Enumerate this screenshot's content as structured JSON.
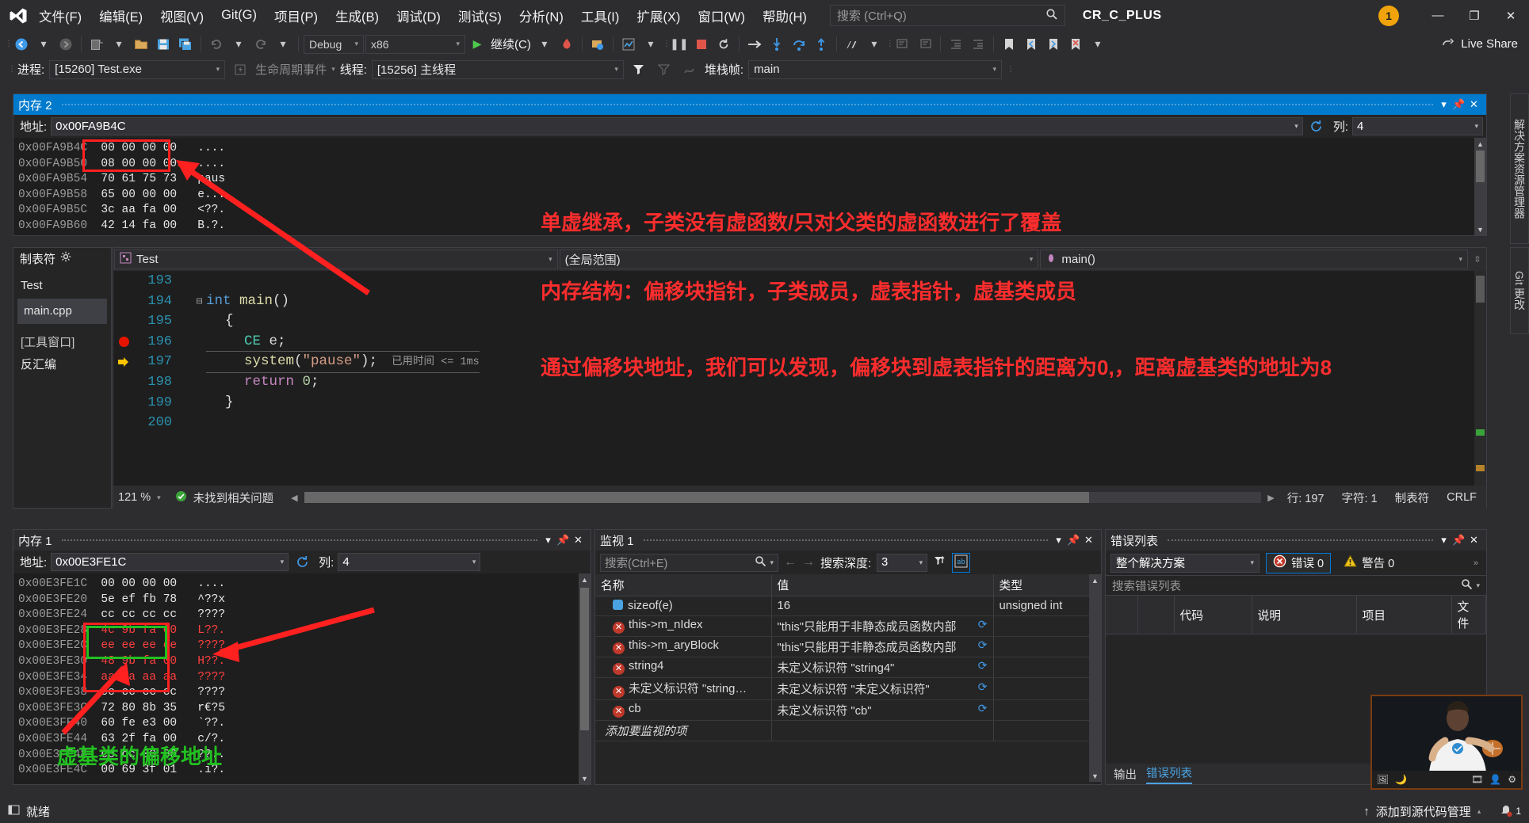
{
  "window": {
    "project_name": "CR_C_PLUS",
    "notification_count": "1",
    "minimize": "—",
    "restore": "❐",
    "close": "✕",
    "live_share": "Live Share"
  },
  "menu": {
    "items": [
      {
        "label": "文件(F)"
      },
      {
        "label": "编辑(E)"
      },
      {
        "label": "视图(V)"
      },
      {
        "label": "Git(G)"
      },
      {
        "label": "项目(P)"
      },
      {
        "label": "生成(B)"
      },
      {
        "label": "调试(D)"
      },
      {
        "label": "测试(S)"
      },
      {
        "label": "分析(N)"
      },
      {
        "label": "工具(I)"
      },
      {
        "label": "扩展(X)"
      },
      {
        "label": "窗口(W)"
      },
      {
        "label": "帮助(H)"
      }
    ],
    "search_placeholder": "搜索 (Ctrl+Q)"
  },
  "toolbar": {
    "configuration": "Debug",
    "platform": "x86",
    "continue_label": "继续(C)"
  },
  "debugbar": {
    "process_label": "进程:",
    "process_value": "[15260] Test.exe",
    "lifecycle_label": "生命周期事件",
    "thread_label": "线程:",
    "thread_value": "[15256] 主线程",
    "stackframe_label": "堆栈帧:",
    "stackframe_value": "main"
  },
  "memory2": {
    "title": "内存 2",
    "address_label": "地址:",
    "address_value": "0x00FA9B4C",
    "column_label": "列:",
    "column_value": "4",
    "rows": [
      {
        "addr": "0x00FA9B4C",
        "hex": "00 00 00 00",
        "ascii": "....",
        "hl": false
      },
      {
        "addr": "0x00FA9B50",
        "hex": "08 00 00 00",
        "ascii": "....",
        "hl": false
      },
      {
        "addr": "0x00FA9B54",
        "hex": "70 61 75 73",
        "ascii": "paus",
        "hl": false
      },
      {
        "addr": "0x00FA9B58",
        "hex": "65 00 00 00",
        "ascii": "e...",
        "hl": false
      },
      {
        "addr": "0x00FA9B5C",
        "hex": "3c aa fa 00",
        "ascii": "<??.",
        "hl": false
      },
      {
        "addr": "0x00FA9B60",
        "hex": "42 14 fa 00",
        "ascii": "B.?.",
        "hl": false
      }
    ]
  },
  "memory1": {
    "title": "内存 1",
    "address_label": "地址:",
    "address_value": "0x00E3FE1C",
    "column_label": "列:",
    "column_value": "4",
    "rows": [
      {
        "addr": "0x00E3FE1C",
        "hex": "00 00 00 00",
        "ascii": "....",
        "hl": false
      },
      {
        "addr": "0x00E3FE20",
        "hex": "5e ef fb 78",
        "ascii": "^??x",
        "hl": false
      },
      {
        "addr": "0x00E3FE24",
        "hex": "cc cc cc cc",
        "ascii": "????",
        "hl": false
      },
      {
        "addr": "0x00E3FE28",
        "hex": "4c 9b fa 00",
        "ascii": "L??.",
        "hl": true
      },
      {
        "addr": "0x00E3FE2C",
        "hex": "ee ee ee ee",
        "ascii": "????",
        "hl": true
      },
      {
        "addr": "0x00E3FE30",
        "hex": "48 9b fa 00",
        "ascii": "H??.",
        "hl": true
      },
      {
        "addr": "0x00E3FE34",
        "hex": "aa aa aa aa",
        "ascii": "????",
        "hl": true
      },
      {
        "addr": "0x00E3FE38",
        "hex": "cc cc cc cc",
        "ascii": "????",
        "hl": false
      },
      {
        "addr": "0x00E3FE3C",
        "hex": "72 80 8b 35",
        "ascii": "r€?5",
        "hl": false
      },
      {
        "addr": "0x00E3FE40",
        "hex": "60 fe e3 00",
        "ascii": "`??.",
        "hl": false
      },
      {
        "addr": "0x00E3FE44",
        "hex": "63 2f fa 00",
        "ascii": "c/?.",
        "hl": false
      },
      {
        "addr": "0x00E3FE48",
        "hex": "cc cc 00 00",
        "ascii": "??..",
        "hl": false
      },
      {
        "addr": "0x00E3FE4C",
        "hex": "00 69 3f 01",
        "ascii": ".i?.",
        "hl": false
      }
    ]
  },
  "sidebar_left": {
    "tab_label": "制表符",
    "project": "Test",
    "file": "main.cpp",
    "section": "[工具窗口]",
    "disasm": "反汇编"
  },
  "editor": {
    "tab_label": "Test",
    "scope_combo": "(全局范围)",
    "member_combo": "main()",
    "lines": [
      {
        "no": "193",
        "segments": []
      },
      {
        "no": "194",
        "segments": [
          {
            "t": "int ",
            "c": "k-blue"
          },
          {
            "t": "main",
            "c": "k-yel"
          },
          {
            "t": "()",
            "c": "k-wht"
          }
        ],
        "fold": true
      },
      {
        "no": "195",
        "segments": [
          {
            "t": "{",
            "c": "k-wht"
          }
        ],
        "indent": 1
      },
      {
        "no": "196",
        "segments": [
          {
            "t": "CE",
            "c": "k-teal"
          },
          {
            "t": " e;",
            "c": "k-wht"
          }
        ],
        "indent": 2,
        "breakpoint": true
      },
      {
        "no": "197",
        "segments": [
          {
            "t": "system",
            "c": "k-yel"
          },
          {
            "t": "(",
            "c": "k-wht"
          },
          {
            "t": "\"pause\"",
            "c": "k-str"
          },
          {
            "t": ");",
            "c": "k-wht"
          }
        ],
        "indent": 2,
        "current": true,
        "inline_hint": "已用时间 <= 1ms"
      },
      {
        "no": "198",
        "segments": [
          {
            "t": "return ",
            "c": "k-mag"
          },
          {
            "t": "0",
            "c": "k-num"
          },
          {
            "t": ";",
            "c": "k-wht"
          }
        ],
        "indent": 2
      },
      {
        "no": "199",
        "segments": [
          {
            "t": "}",
            "c": "k-wht"
          }
        ],
        "indent": 1
      },
      {
        "no": "200",
        "segments": []
      }
    ],
    "zoom": "121 %",
    "issues": "未找到相关问题",
    "line_label": "行: 197",
    "char_label": "字符: 1",
    "tabs_label": "制表符",
    "eol_label": "CRLF"
  },
  "watch": {
    "title": "监视 1",
    "search_placeholder": "搜索(Ctrl+E)",
    "depth_label": "搜索深度:",
    "depth_value": "3",
    "columns": [
      "名称",
      "值",
      "类型"
    ],
    "rows": [
      {
        "name": "sizeof(e)",
        "value": "16",
        "type": "unsigned int",
        "icon": "blue",
        "refresh": false
      },
      {
        "name": "this->m_nIdex",
        "value": "\"this\"只能用于非静态成员函数内部",
        "type": "",
        "icon": "error",
        "refresh": true
      },
      {
        "name": "this->m_aryBlock",
        "value": "\"this\"只能用于非静态成员函数内部",
        "type": "",
        "icon": "error",
        "refresh": true
      },
      {
        "name": "string4",
        "value": "未定义标识符 \"string4\"",
        "type": "",
        "icon": "error",
        "refresh": true
      },
      {
        "name": "未定义标识符 \"string…",
        "value": "未定义标识符 \"未定义标识符\"",
        "type": "",
        "icon": "error",
        "refresh": true
      },
      {
        "name": "cb",
        "value": "未定义标识符 \"cb\"",
        "type": "",
        "icon": "error",
        "refresh": true
      }
    ],
    "add_row": "添加要监视的项"
  },
  "errorlist": {
    "title": "错误列表",
    "scope": "整个解决方案",
    "errors_label": "错误 0",
    "warnings_label": "警告 0",
    "search_placeholder": "搜索错误列表",
    "columns": [
      "",
      "",
      "代码",
      "说明",
      "项目",
      "文件"
    ],
    "tabs": [
      {
        "label": "输出"
      },
      {
        "label": "错误列表"
      }
    ]
  },
  "right_vtabs": [
    {
      "label": "解决方案资源管理器"
    },
    {
      "label": "Git 更改"
    }
  ],
  "statusbar": {
    "ready": "就绪",
    "source_control": "添加到源代码管理",
    "notif": "1"
  },
  "annotations": [
    {
      "id": "ann-inherit",
      "text": "单虚继承，子类没有虚函数/只对父类的虚函数进行了覆盖",
      "color": "#ff2d2d"
    },
    {
      "id": "ann-layout",
      "text": "内存结构：偏移块指针，子类成员，虚表指针，虚基类成员",
      "color": "#ff2d2d"
    },
    {
      "id": "ann-offset",
      "text": "通过偏移块地址，我们可以发现，偏移块到虚表指针的距离为0,，距离虚基类的地址为8",
      "color": "#ff2d2d"
    },
    {
      "id": "ann-vbase",
      "text": "虚基类的偏移地址",
      "color": "#22c020"
    }
  ],
  "colors": {
    "accent": "#007acc",
    "annotation_red": "#ff2d2d",
    "annotation_green": "#22c020",
    "error_red": "#c0392b",
    "warning_yellow": "#f0c419",
    "editor_bg": "#1e1e1e",
    "chrome_bg": "#2d2d30"
  }
}
